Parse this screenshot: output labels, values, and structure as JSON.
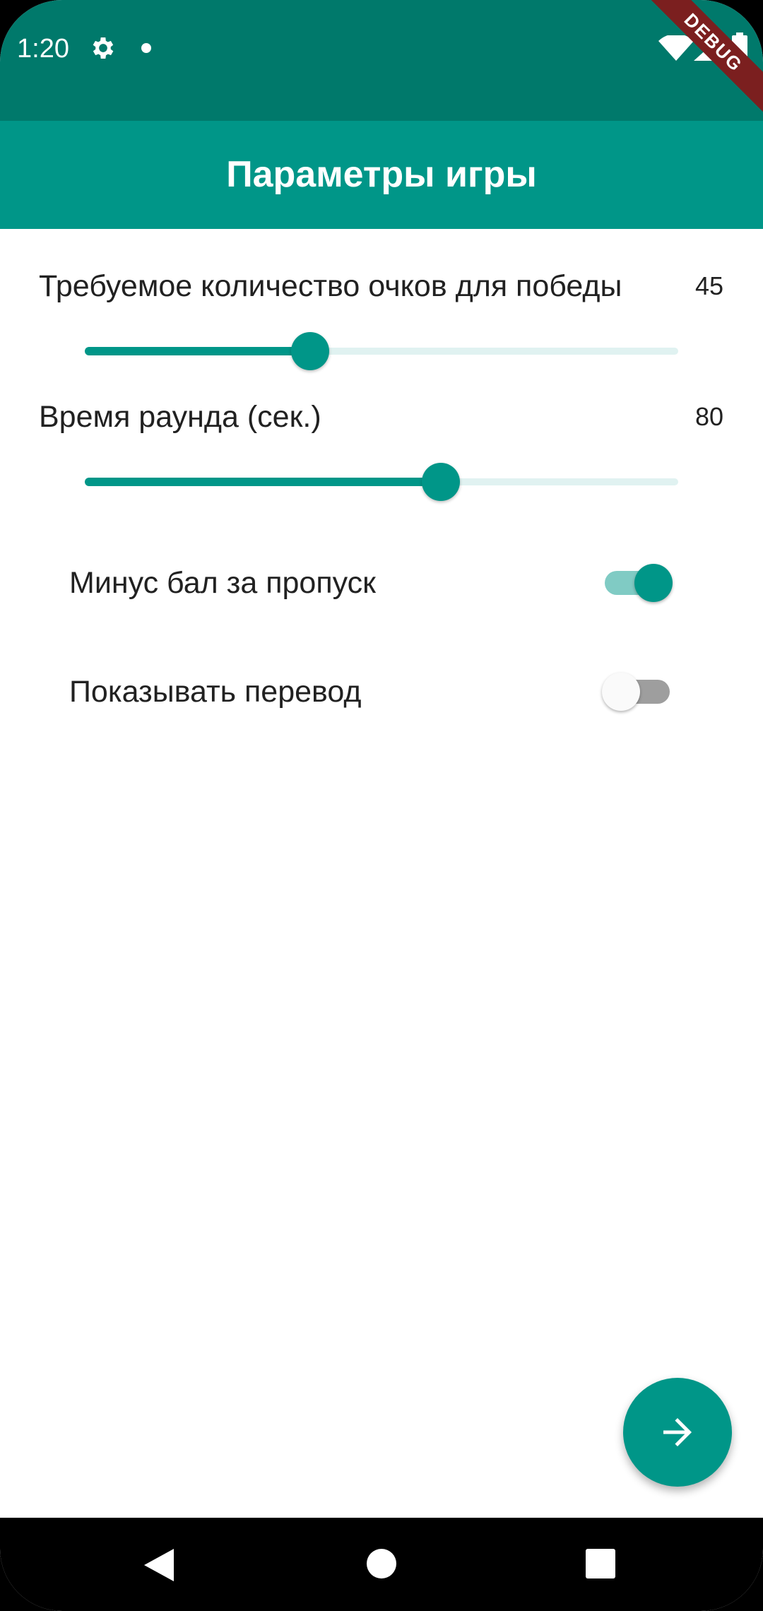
{
  "status_bar": {
    "time": "1:20",
    "debug_label": "DEBUG"
  },
  "app_bar": {
    "title": "Параметры игры"
  },
  "settings": {
    "points_to_win": {
      "label": "Требуемое количество очков для победы",
      "value": "45",
      "slider_fraction": 0.38
    },
    "round_time": {
      "label": "Время раунда (сек.)",
      "value": "80",
      "slider_fraction": 0.6
    }
  },
  "toggles": [
    {
      "label": "Минус бал за пропуск",
      "on": true
    },
    {
      "label": "Показывать перевод",
      "on": false
    }
  ],
  "colors": {
    "primary": "#009688",
    "primary_dark": "#00796b",
    "track_light": "#e0f2f1"
  }
}
